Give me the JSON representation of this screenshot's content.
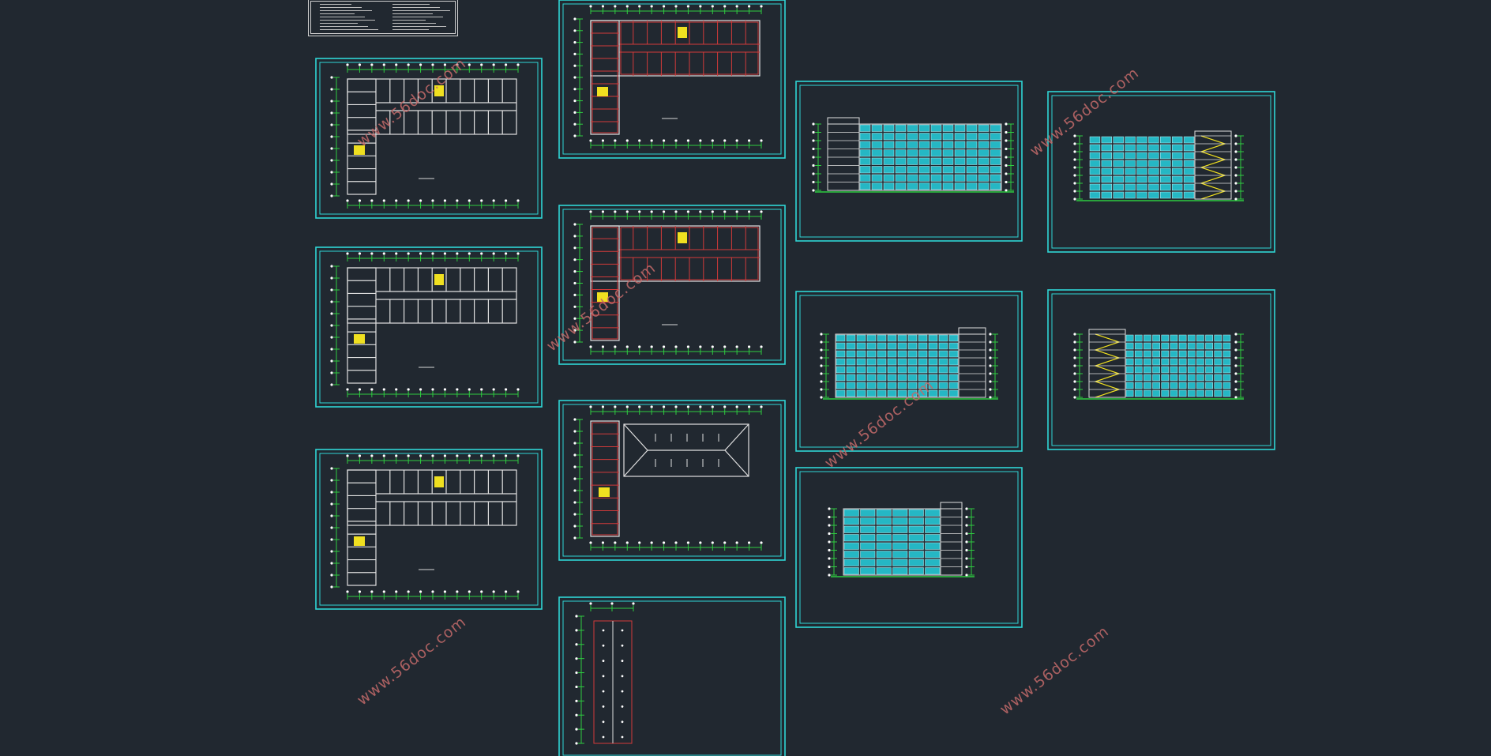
{
  "canvas": {
    "background": "#212830"
  },
  "colors": {
    "frame": "#2fd6d6",
    "axis": "#2ecc40",
    "partition": "#d23a3a",
    "stair": "#f0e020",
    "glazing": "#25b7c4",
    "watermark": "#c46a6a"
  },
  "watermark_text": "www.56doc.com",
  "sheets": [
    {
      "id": "plan-1",
      "type": "plan-L"
    },
    {
      "id": "plan-2",
      "type": "plan-L"
    },
    {
      "id": "plan-3",
      "type": "plan-L"
    },
    {
      "id": "plan-4",
      "type": "plan-L-red"
    },
    {
      "id": "plan-5",
      "type": "plan-L-red"
    },
    {
      "id": "roof-plan",
      "type": "roof"
    },
    {
      "id": "stair-detail",
      "type": "narrow"
    },
    {
      "id": "elevation-1",
      "type": "elevation"
    },
    {
      "id": "elevation-2",
      "type": "elevation"
    },
    {
      "id": "elevation-3",
      "type": "elevation"
    },
    {
      "id": "section-1",
      "type": "section"
    },
    {
      "id": "section-2",
      "type": "section"
    }
  ]
}
